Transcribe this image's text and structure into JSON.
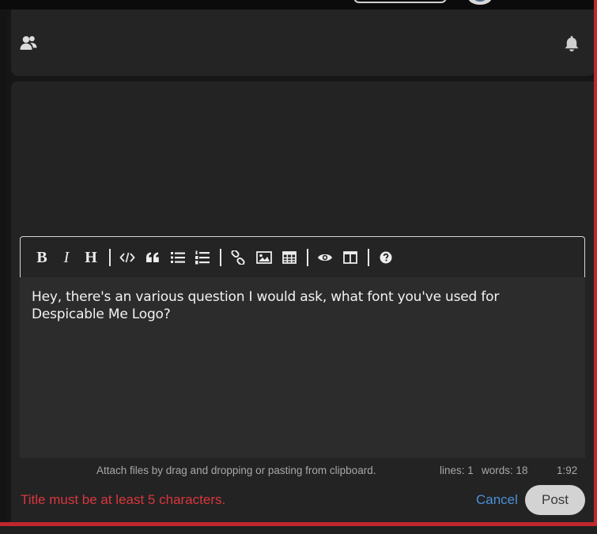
{
  "header": {
    "users_icon": "users-icon",
    "bell_icon": "bell-icon"
  },
  "toolbar": {
    "bold": "B",
    "italic": "I",
    "heading": "H",
    "icons": [
      "bold-icon",
      "italic-icon",
      "heading-icon",
      "code-icon",
      "quote-icon",
      "bullet-list-icon",
      "numbered-list-icon",
      "link-icon",
      "image-icon",
      "table-icon",
      "preview-icon",
      "side-by-side-icon",
      "help-icon"
    ]
  },
  "editor": {
    "text": "Hey, there's an various question I would ask, what font you've used for Despicable Me Logo?"
  },
  "status_bar": {
    "attach_hint": "Attach files by drag and dropping or pasting from clipboard.",
    "lines": "lines: 1",
    "words": "words: 18",
    "cursor": "1:92"
  },
  "footer": {
    "error": "Title must be at least 5 characters.",
    "cancel_label": "Cancel",
    "post_label": "Post"
  },
  "colors": {
    "background": "#161616",
    "panel": "#242424",
    "editor_bg": "#2c2c2c",
    "error_red": "#d9363e",
    "link_blue": "#4a90d9",
    "accent_border": "#c1272d"
  }
}
